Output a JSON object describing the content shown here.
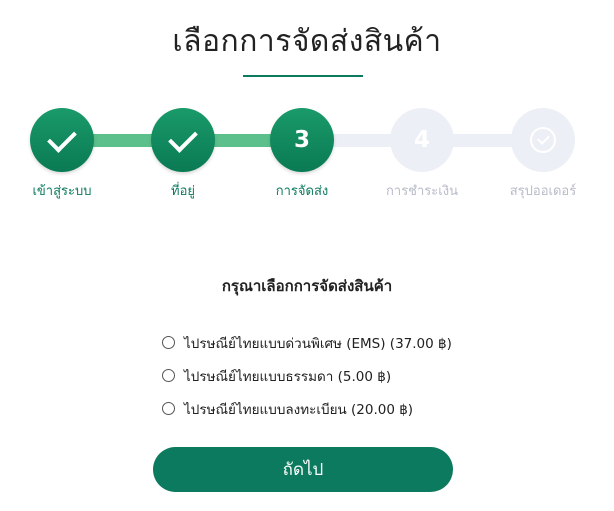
{
  "page": {
    "title": "เลือกการจัดส่งสินค้า"
  },
  "stepper": {
    "steps": [
      {
        "label": "เข้าสู่ระบบ",
        "status": "done",
        "icon": "check-icon"
      },
      {
        "label": "ที่อยู่",
        "status": "done",
        "icon": "check-icon"
      },
      {
        "label": "การจัดส่ง",
        "status": "active",
        "number": "3"
      },
      {
        "label": "การชำระเงิน",
        "status": "pending",
        "number": "4"
      },
      {
        "label": "สรุปออเดอร์",
        "status": "pending",
        "icon": "check-circle-icon"
      }
    ],
    "colors": {
      "done": "#0c7a5e",
      "connector_done": "#5cc08c",
      "pending": "#edeff6",
      "pending_label": "#b8bcc8"
    }
  },
  "shipping": {
    "question": "กรุณาเลือกการจัดส่งสินค้า",
    "options": [
      {
        "label": "ไปรษณีย์ไทยแบบด่วนพิเศษ (EMS) (37.00 ฿)",
        "selected": false
      },
      {
        "label": "ไปรษณีย์ไทยแบบธรรมดา (5.00 ฿)",
        "selected": false
      },
      {
        "label": "ไปรษณีย์ไทยแบบลงทะเบียน (20.00 ฿)",
        "selected": false
      }
    ]
  },
  "actions": {
    "next_label": "ถัดไป"
  }
}
